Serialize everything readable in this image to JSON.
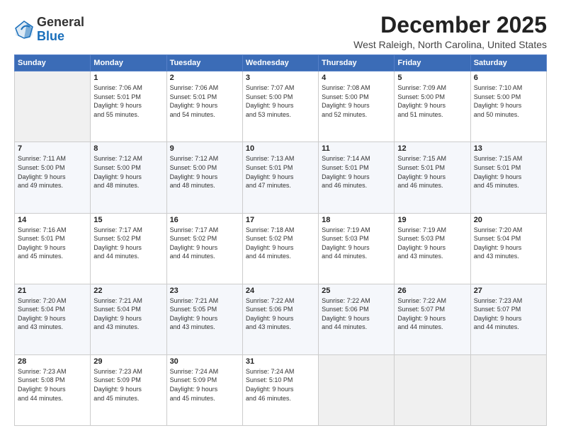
{
  "header": {
    "logo": {
      "general": "General",
      "blue": "Blue"
    },
    "title": "December 2025",
    "location": "West Raleigh, North Carolina, United States"
  },
  "weekdays": [
    "Sunday",
    "Monday",
    "Tuesday",
    "Wednesday",
    "Thursday",
    "Friday",
    "Saturday"
  ],
  "weeks": [
    [
      {
        "day": "",
        "empty": true
      },
      {
        "day": "1",
        "sunrise": "7:06 AM",
        "sunset": "5:01 PM",
        "daylight": "9 hours and 55 minutes."
      },
      {
        "day": "2",
        "sunrise": "7:06 AM",
        "sunset": "5:01 PM",
        "daylight": "9 hours and 54 minutes."
      },
      {
        "day": "3",
        "sunrise": "7:07 AM",
        "sunset": "5:00 PM",
        "daylight": "9 hours and 53 minutes."
      },
      {
        "day": "4",
        "sunrise": "7:08 AM",
        "sunset": "5:00 PM",
        "daylight": "9 hours and 52 minutes."
      },
      {
        "day": "5",
        "sunrise": "7:09 AM",
        "sunset": "5:00 PM",
        "daylight": "9 hours and 51 minutes."
      },
      {
        "day": "6",
        "sunrise": "7:10 AM",
        "sunset": "5:00 PM",
        "daylight": "9 hours and 50 minutes."
      }
    ],
    [
      {
        "day": "7",
        "sunrise": "7:11 AM",
        "sunset": "5:00 PM",
        "daylight": "9 hours and 49 minutes."
      },
      {
        "day": "8",
        "sunrise": "7:12 AM",
        "sunset": "5:00 PM",
        "daylight": "9 hours and 48 minutes."
      },
      {
        "day": "9",
        "sunrise": "7:12 AM",
        "sunset": "5:00 PM",
        "daylight": "9 hours and 48 minutes."
      },
      {
        "day": "10",
        "sunrise": "7:13 AM",
        "sunset": "5:01 PM",
        "daylight": "9 hours and 47 minutes."
      },
      {
        "day": "11",
        "sunrise": "7:14 AM",
        "sunset": "5:01 PM",
        "daylight": "9 hours and 46 minutes."
      },
      {
        "day": "12",
        "sunrise": "7:15 AM",
        "sunset": "5:01 PM",
        "daylight": "9 hours and 46 minutes."
      },
      {
        "day": "13",
        "sunrise": "7:15 AM",
        "sunset": "5:01 PM",
        "daylight": "9 hours and 45 minutes."
      }
    ],
    [
      {
        "day": "14",
        "sunrise": "7:16 AM",
        "sunset": "5:01 PM",
        "daylight": "9 hours and 45 minutes."
      },
      {
        "day": "15",
        "sunrise": "7:17 AM",
        "sunset": "5:02 PM",
        "daylight": "9 hours and 44 minutes."
      },
      {
        "day": "16",
        "sunrise": "7:17 AM",
        "sunset": "5:02 PM",
        "daylight": "9 hours and 44 minutes."
      },
      {
        "day": "17",
        "sunrise": "7:18 AM",
        "sunset": "5:02 PM",
        "daylight": "9 hours and 44 minutes."
      },
      {
        "day": "18",
        "sunrise": "7:19 AM",
        "sunset": "5:03 PM",
        "daylight": "9 hours and 44 minutes."
      },
      {
        "day": "19",
        "sunrise": "7:19 AM",
        "sunset": "5:03 PM",
        "daylight": "9 hours and 43 minutes."
      },
      {
        "day": "20",
        "sunrise": "7:20 AM",
        "sunset": "5:04 PM",
        "daylight": "9 hours and 43 minutes."
      }
    ],
    [
      {
        "day": "21",
        "sunrise": "7:20 AM",
        "sunset": "5:04 PM",
        "daylight": "9 hours and 43 minutes."
      },
      {
        "day": "22",
        "sunrise": "7:21 AM",
        "sunset": "5:04 PM",
        "daylight": "9 hours and 43 minutes."
      },
      {
        "day": "23",
        "sunrise": "7:21 AM",
        "sunset": "5:05 PM",
        "daylight": "9 hours and 43 minutes."
      },
      {
        "day": "24",
        "sunrise": "7:22 AM",
        "sunset": "5:06 PM",
        "daylight": "9 hours and 43 minutes."
      },
      {
        "day": "25",
        "sunrise": "7:22 AM",
        "sunset": "5:06 PM",
        "daylight": "9 hours and 44 minutes."
      },
      {
        "day": "26",
        "sunrise": "7:22 AM",
        "sunset": "5:07 PM",
        "daylight": "9 hours and 44 minutes."
      },
      {
        "day": "27",
        "sunrise": "7:23 AM",
        "sunset": "5:07 PM",
        "daylight": "9 hours and 44 minutes."
      }
    ],
    [
      {
        "day": "28",
        "sunrise": "7:23 AM",
        "sunset": "5:08 PM",
        "daylight": "9 hours and 44 minutes."
      },
      {
        "day": "29",
        "sunrise": "7:23 AM",
        "sunset": "5:09 PM",
        "daylight": "9 hours and 45 minutes."
      },
      {
        "day": "30",
        "sunrise": "7:24 AM",
        "sunset": "5:09 PM",
        "daylight": "9 hours and 45 minutes."
      },
      {
        "day": "31",
        "sunrise": "7:24 AM",
        "sunset": "5:10 PM",
        "daylight": "9 hours and 46 minutes."
      },
      {
        "day": "",
        "empty": true
      },
      {
        "day": "",
        "empty": true
      },
      {
        "day": "",
        "empty": true
      }
    ]
  ],
  "labels": {
    "sunrise": "Sunrise:",
    "sunset": "Sunset:",
    "daylight": "Daylight:"
  }
}
